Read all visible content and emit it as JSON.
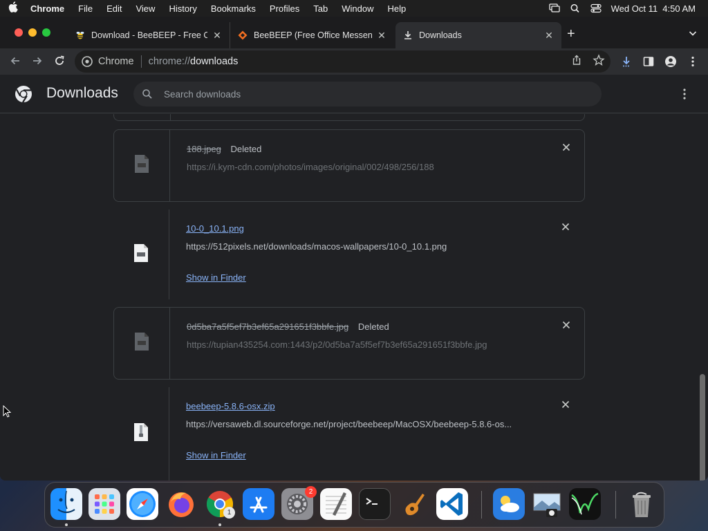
{
  "menubar": {
    "app_name": "Chrome",
    "items": [
      "File",
      "Edit",
      "View",
      "History",
      "Bookmarks",
      "Profiles",
      "Tab",
      "Window",
      "Help"
    ],
    "datetime": "Wed Oct 11  4:50 AM"
  },
  "tabs": [
    {
      "title": "Download - BeeBEEP - Free O",
      "icon": "bee-icon"
    },
    {
      "title": "BeeBEEP (Free Office Messen",
      "icon": "sourceforge-icon"
    },
    {
      "title": "Downloads",
      "icon": "download-icon",
      "active": true
    }
  ],
  "toolbar": {
    "site_label": "Chrome",
    "url_scheme": "chrome://",
    "url_host": "downloads"
  },
  "downloads_page": {
    "title": "Downloads",
    "search_placeholder": "Search downloads",
    "items": [
      {
        "filename": "188.jpeg",
        "status": "Deleted",
        "url": "https://i.kym-cdn.com/photos/images/original/002/498/256/188",
        "deleted": true
      },
      {
        "filename": "10-0_10.1.png",
        "url": "https://512pixels.net/downloads/macos-wallpapers/10-0_10.1.png",
        "action": "Show in Finder",
        "deleted": false
      },
      {
        "filename": "0d5ba7a5f5ef7b3ef65a291651f3bbfe.jpg",
        "status": "Deleted",
        "url": "https://tupian435254.com:1443/p2/0d5ba7a5f5ef7b3ef65a291651f3bbfe.jpg",
        "deleted": true
      },
      {
        "filename": "beebeep-5.8.6-osx.zip",
        "url": "https://versaweb.dl.sourceforge.net/project/beebeep/MacOSX/beebeep-5.8.6-os...",
        "action": "Show in Finder",
        "deleted": false
      }
    ]
  },
  "dock": {
    "apps": [
      "Finder",
      "Launchpad",
      "Safari",
      "Firefox",
      "Chrome",
      "App Store",
      "System Settings",
      "TextEdit",
      "Terminal",
      "GarageBand",
      "Visual Studio Code",
      "Weather",
      "Preview",
      "Activity Monitor",
      "Trash"
    ],
    "settings_badge": "2",
    "chrome_badge": "1"
  },
  "colors": {
    "link": "#8ab4f8",
    "page_bg": "#202124",
    "muted_text": "#9aa0a6"
  }
}
